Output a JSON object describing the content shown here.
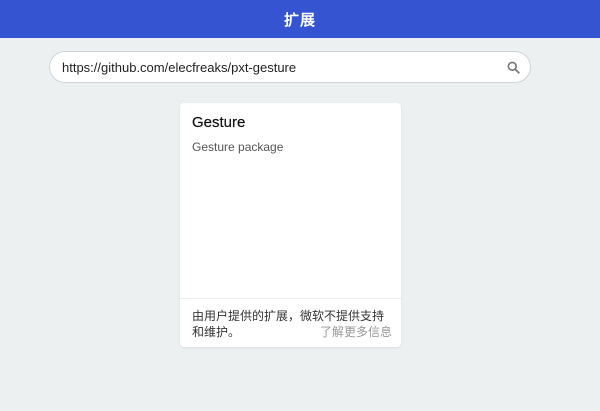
{
  "header": {
    "title": "扩展"
  },
  "search": {
    "value": "https://github.com/elecfreaks/pxt-gesture",
    "icon": "search-icon"
  },
  "results": [
    {
      "title": "Gesture",
      "description": "Gesture package",
      "footer_text": "由用户提供的扩展，微软不提供支持和维护。",
      "learn_more_label": "了解更多信息"
    }
  ],
  "colors": {
    "header_bg": "#3454d1",
    "page_bg": "#ecf0f1",
    "card_bg": "#ffffff"
  }
}
